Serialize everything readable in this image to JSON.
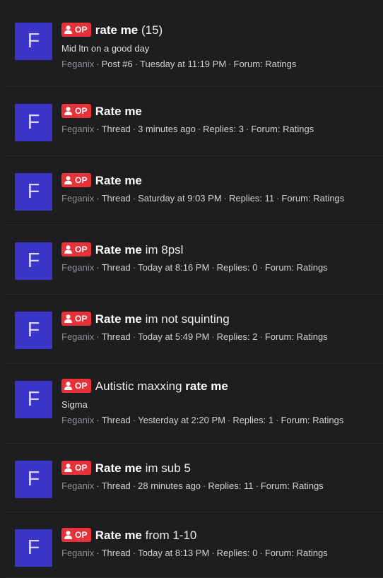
{
  "badge_label": "OP",
  "colors": {
    "background": "#1e1e20",
    "avatar": "#3b35c9",
    "badge": "#e8323a"
  },
  "results": [
    {
      "avatar_letter": "F",
      "title_parts": [
        {
          "text": "rate me",
          "bold": true
        },
        {
          "text": " (15)",
          "bold": false
        }
      ],
      "snippet": "Mid ltn on a good day",
      "meta": [
        "Feganix",
        "Post #6",
        "Tuesday at 11:19 PM",
        "Forum: Ratings"
      ]
    },
    {
      "avatar_letter": "F",
      "title_parts": [
        {
          "text": "Rate me",
          "bold": true
        }
      ],
      "snippet": null,
      "meta": [
        "Feganix",
        "Thread",
        "3 minutes ago",
        "Replies: 3",
        "Forum: Ratings"
      ]
    },
    {
      "avatar_letter": "F",
      "title_parts": [
        {
          "text": "Rate me",
          "bold": true
        }
      ],
      "snippet": null,
      "meta": [
        "Feganix",
        "Thread",
        "Saturday at 9:03 PM",
        "Replies: 11",
        "Forum: Ratings"
      ]
    },
    {
      "avatar_letter": "F",
      "title_parts": [
        {
          "text": "Rate me",
          "bold": true
        },
        {
          "text": " im 8psl",
          "bold": false
        }
      ],
      "snippet": null,
      "meta": [
        "Feganix",
        "Thread",
        "Today at 8:16 PM",
        "Replies: 0",
        "Forum: Ratings"
      ]
    },
    {
      "avatar_letter": "F",
      "title_parts": [
        {
          "text": "Rate me",
          "bold": true
        },
        {
          "text": " im not squinting",
          "bold": false
        }
      ],
      "snippet": null,
      "meta": [
        "Feganix",
        "Thread",
        "Today at 5:49 PM",
        "Replies: 2",
        "Forum: Ratings"
      ]
    },
    {
      "avatar_letter": "F",
      "title_parts": [
        {
          "text": "Autistic maxxing ",
          "bold": false
        },
        {
          "text": "rate me",
          "bold": true
        }
      ],
      "snippet": "Sigma",
      "meta": [
        "Feganix",
        "Thread",
        "Yesterday at 2:20 PM",
        "Replies: 1",
        "Forum: Ratings"
      ]
    },
    {
      "avatar_letter": "F",
      "title_parts": [
        {
          "text": "Rate me",
          "bold": true
        },
        {
          "text": " im sub 5",
          "bold": false
        }
      ],
      "snippet": null,
      "meta": [
        "Feganix",
        "Thread",
        "28 minutes ago",
        "Replies: 11",
        "Forum: Ratings"
      ]
    },
    {
      "avatar_letter": "F",
      "title_parts": [
        {
          "text": "Rate me",
          "bold": true
        },
        {
          "text": " from 1-10",
          "bold": false
        }
      ],
      "snippet": null,
      "meta": [
        "Feganix",
        "Thread",
        "Today at 8:13 PM",
        "Replies: 0",
        "Forum: Ratings"
      ]
    }
  ]
}
